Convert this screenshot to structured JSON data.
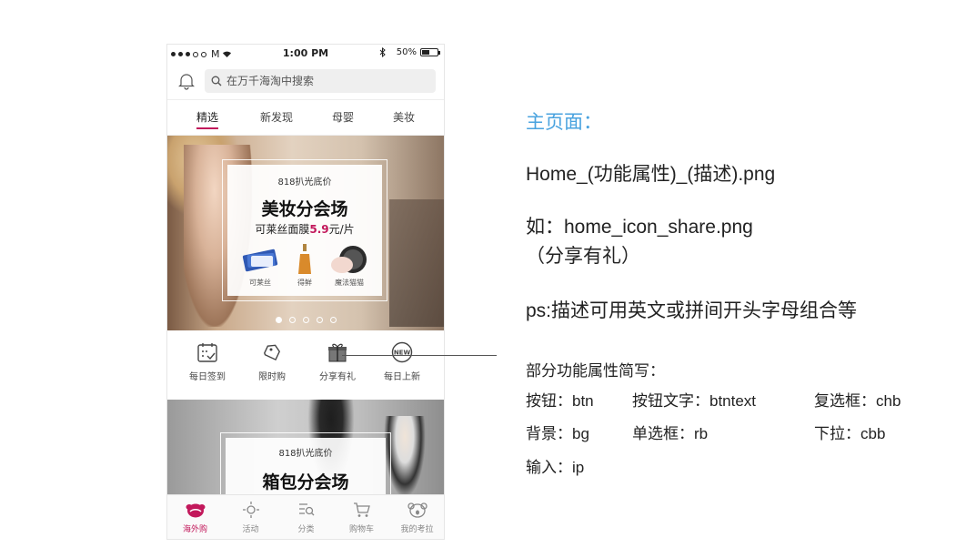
{
  "status_bar": {
    "carrier": "M",
    "time": "1:00 PM",
    "battery": "50%"
  },
  "search": {
    "placeholder": "在万千海淘中搜索"
  },
  "tabs": [
    "精选",
    "新发现",
    "母婴",
    "美妆"
  ],
  "banner": {
    "subtitle": "818扒光底价",
    "title": "美妆分会场",
    "price_prefix": "可莱丝面膜",
    "price_value": "5.9",
    "price_suffix": "元/片",
    "products": [
      "可莱丝",
      "得鲜",
      "魔法猫猫"
    ],
    "dots": 5,
    "active_dot": 0
  },
  "quick_actions": [
    "每日签到",
    "限时购",
    "分享有礼",
    "每日上新"
  ],
  "new_badge": "NEW",
  "banner2": {
    "subtitle": "818扒光底价",
    "title": "箱包分会场"
  },
  "bottom_tabs": [
    "海外购",
    "活动",
    "分类",
    "购物车",
    "我的考拉"
  ],
  "notes": {
    "title": "主页面：",
    "line1": "Home_(功能属性)_(描述).png",
    "line2": "如：home_icon_share.png",
    "line3": "（分享有礼）",
    "line4": "ps:描述可用英文或拼间开头字母组合等",
    "abbr_title": "部分功能属性简写：",
    "abbr": [
      "按钮：btn",
      "按钮文字：btntext",
      "复选框：chb",
      "背景：bg",
      "单选框：rb",
      "下拉：cbb",
      "输入：ip"
    ]
  },
  "colors": {
    "accent": "#c2185b",
    "note_title": "#4aa3df"
  }
}
